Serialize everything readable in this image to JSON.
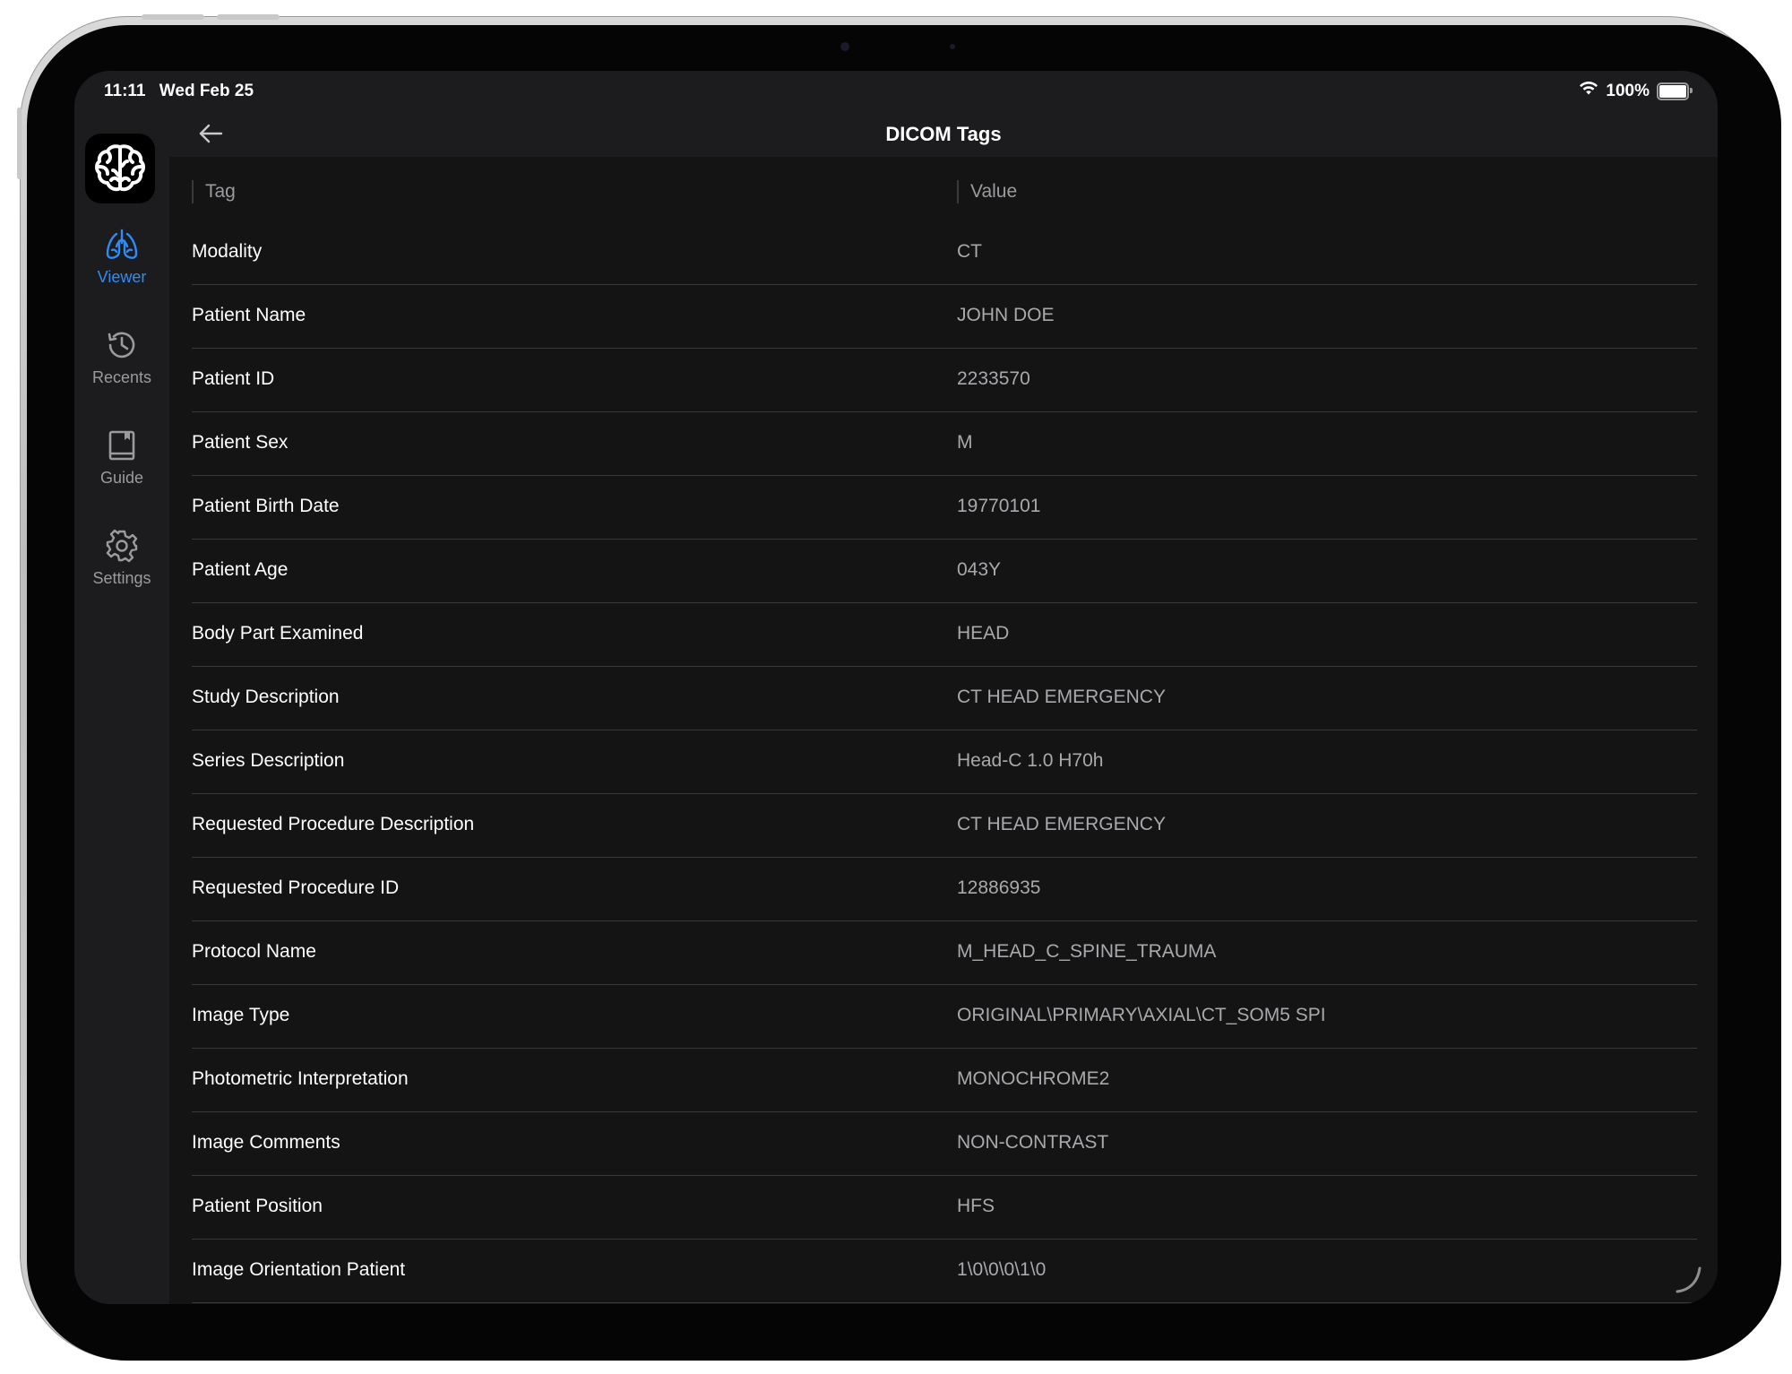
{
  "status_bar": {
    "time": "11:11",
    "date": "Wed Feb 25",
    "battery": "100%"
  },
  "sidebar": {
    "items": [
      {
        "label": "Viewer",
        "icon": "lungs-icon",
        "active": true
      },
      {
        "label": "Recents",
        "icon": "clock-history-icon",
        "active": false
      },
      {
        "label": "Guide",
        "icon": "book-icon",
        "active": false
      },
      {
        "label": "Settings",
        "icon": "gear-icon",
        "active": false
      }
    ]
  },
  "header": {
    "title": "DICOM Tags"
  },
  "table": {
    "columns": [
      "Tag",
      "Value"
    ],
    "rows": [
      {
        "tag": "Modality",
        "value": "CT"
      },
      {
        "tag": "Patient Name",
        "value": "JOHN DOE"
      },
      {
        "tag": "Patient ID",
        "value": "2233570"
      },
      {
        "tag": "Patient Sex",
        "value": "M"
      },
      {
        "tag": "Patient Birth Date",
        "value": "19770101"
      },
      {
        "tag": "Patient Age",
        "value": "043Y"
      },
      {
        "tag": "Body Part Examined",
        "value": "HEAD"
      },
      {
        "tag": "Study Description",
        "value": "CT  HEAD EMERGENCY"
      },
      {
        "tag": "Series Description",
        "value": "Head-C  1.0  H70h"
      },
      {
        "tag": "Requested Procedure Description",
        "value": "CT  HEAD EMERGENCY"
      },
      {
        "tag": "Requested Procedure ID",
        "value": "12886935"
      },
      {
        "tag": "Protocol Name",
        "value": "M_HEAD_C_SPINE_TRAUMA"
      },
      {
        "tag": "Image Type",
        "value": "ORIGINAL\\PRIMARY\\AXIAL\\CT_SOM5 SPI"
      },
      {
        "tag": "Photometric Interpretation",
        "value": "MONOCHROME2"
      },
      {
        "tag": "Image Comments",
        "value": "NON-CONTRAST"
      },
      {
        "tag": "Patient Position",
        "value": "HFS"
      },
      {
        "tag": "Image Orientation Patient",
        "value": "1\\0\\0\\0\\1\\0"
      }
    ]
  },
  "colors": {
    "accent": "#2f8cf6",
    "background": "#141414",
    "sidebar": "#1c1c1e",
    "separator": "#3a3a3c",
    "value_text": "#a9a9ad"
  }
}
